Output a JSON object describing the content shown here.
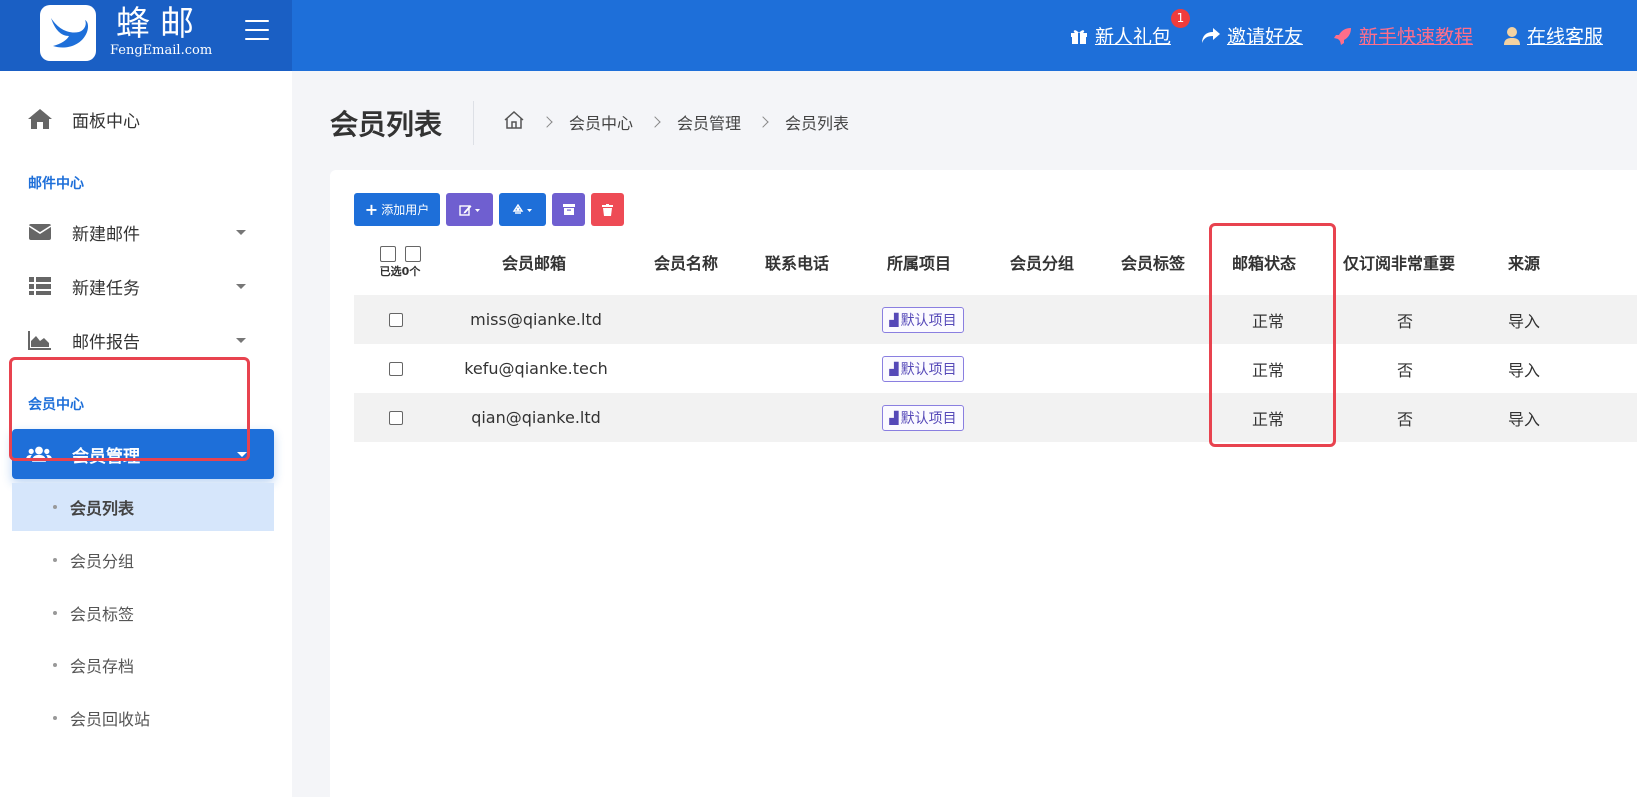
{
  "brand": {
    "name": "蜂邮",
    "subtitle": "FengEmail.com"
  },
  "top_links": [
    {
      "label": "新人礼包",
      "icon": "gift-icon",
      "badge": "1"
    },
    {
      "label": "邀请好友",
      "icon": "share-icon"
    },
    {
      "label": "新手快速教程",
      "icon": "rocket-icon"
    },
    {
      "label": "在线客服",
      "icon": "user-icon"
    }
  ],
  "sidebar": {
    "dashboard": "面板中心",
    "section_mail": "邮件中心",
    "mail_items": [
      "新建邮件",
      "新建任务",
      "邮件报告"
    ],
    "section_member": "会员中心",
    "member_manage": "会员管理",
    "sub_items": [
      "会员列表",
      "会员分组",
      "会员标签",
      "会员存档",
      "会员回收站"
    ]
  },
  "page": {
    "title": "会员列表",
    "breadcrumb": [
      "会员中心",
      "会员管理",
      "会员列表"
    ]
  },
  "toolbar": {
    "add_user": "添加用户"
  },
  "table": {
    "selected_label": "已选0个",
    "headers": [
      "会员邮箱",
      "会员名称",
      "联系电话",
      "所属项目",
      "会员分组",
      "会员标签",
      "邮箱状态",
      "仅订阅非常重要",
      "来源"
    ],
    "rows": [
      {
        "email": "miss@qianke.ltd",
        "name": "",
        "phone": "",
        "project": "默认项目",
        "group": "",
        "tag": "",
        "status": "正常",
        "important_only": "否",
        "source": "导入"
      },
      {
        "email": "kefu@qianke.tech",
        "name": "",
        "phone": "",
        "project": "默认项目",
        "group": "",
        "tag": "",
        "status": "正常",
        "important_only": "否",
        "source": "导入"
      },
      {
        "email": "qian@qianke.ltd",
        "name": "",
        "phone": "",
        "project": "默认项目",
        "group": "",
        "tag": "",
        "status": "正常",
        "important_only": "否",
        "source": "导入"
      }
    ]
  },
  "colors": {
    "primary": "#1e6fd9",
    "purple": "#6f5fd0",
    "danger": "#ee4b55",
    "highlight": "#e8434f"
  }
}
